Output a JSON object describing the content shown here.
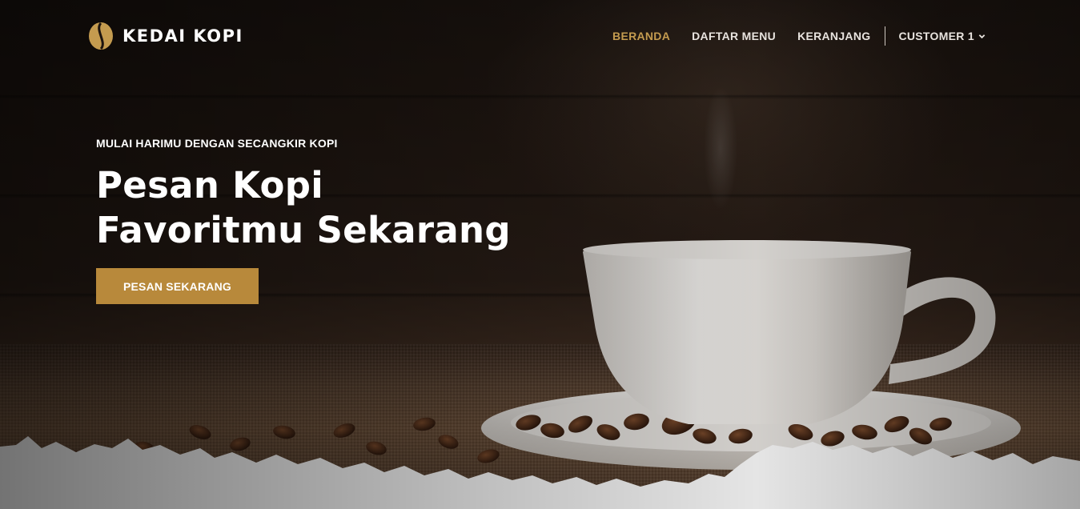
{
  "header": {
    "brand_name": "KEDAI KOPI",
    "brand_icon": "coffee-bean-icon",
    "nav": [
      {
        "label": "BERANDA",
        "active": true
      },
      {
        "label": "DAFTAR MENU",
        "active": false
      },
      {
        "label": "KERANJANG",
        "active": false
      }
    ],
    "user_label": "CUSTOMER 1",
    "user_icon": "chevron-down-icon"
  },
  "hero": {
    "eyebrow": "MULAI HARIMU DENGAN SECANGKIR KOPI",
    "headline_line1": "Pesan Kopi",
    "headline_line2": "Favoritmu Sekarang",
    "cta_label": "PESAN SEKARANG"
  },
  "colors": {
    "accent": "#c49b4f",
    "button": "#b8893b",
    "text": "#ffffff"
  }
}
